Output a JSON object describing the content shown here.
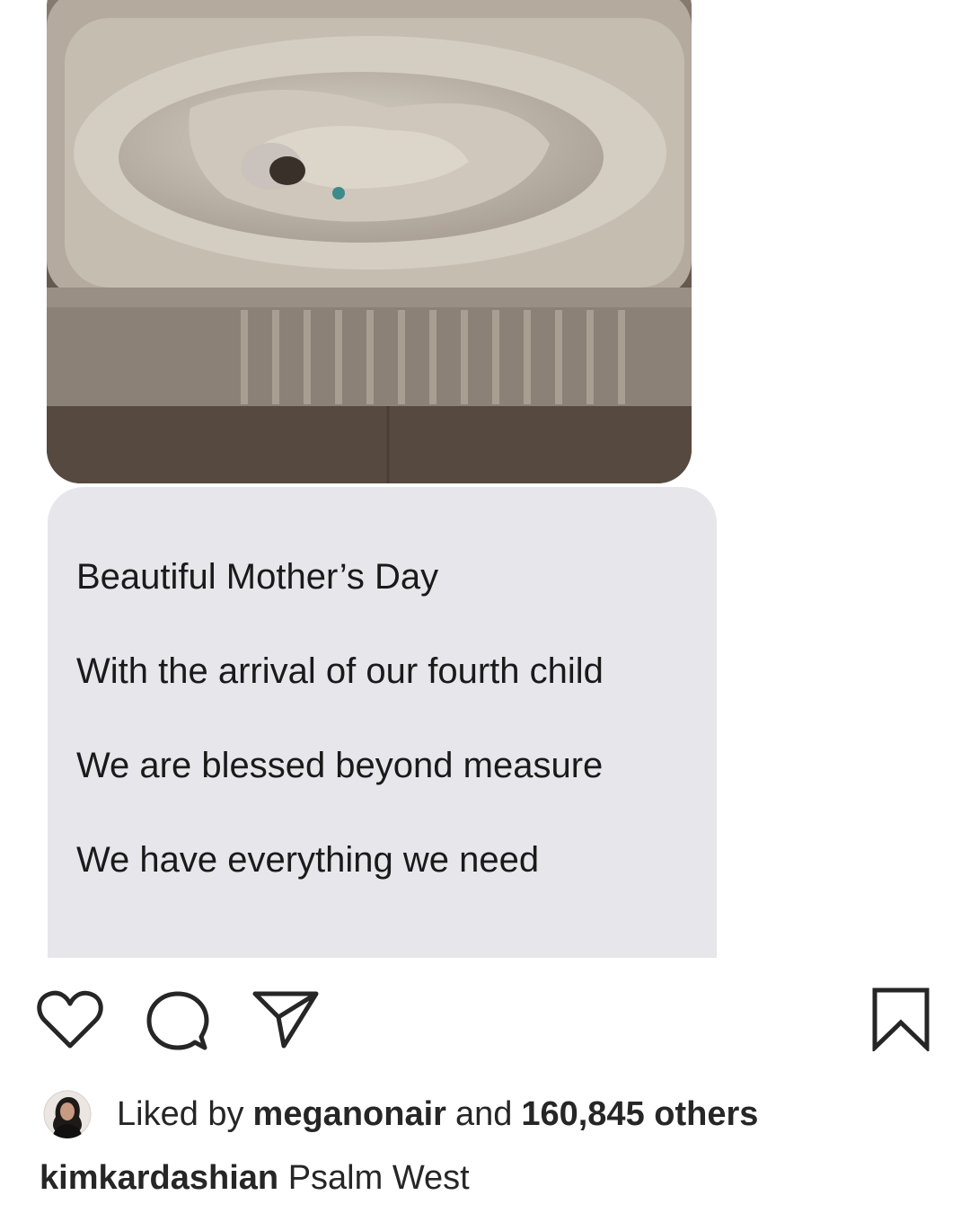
{
  "post": {
    "image_alt": "Newborn swaddled in a white bassinet inside a crib",
    "message_lines": [
      "Beautiful Mother’s Day",
      "With the arrival of our fourth child",
      "We are blessed beyond measure",
      "We have everything we need"
    ]
  },
  "actions": {
    "like_icon": "heart-icon",
    "comment_icon": "comment-icon",
    "share_icon": "paper-plane-icon",
    "save_icon": "bookmark-icon"
  },
  "likes": {
    "prefix": "Liked by",
    "user": "meganonair",
    "middle": "and",
    "count_text": "160,845 others"
  },
  "caption": {
    "username": "kimkardashian",
    "text": "Psalm West"
  },
  "colors": {
    "bubble": "#e6e6eb",
    "text": "#262626"
  }
}
